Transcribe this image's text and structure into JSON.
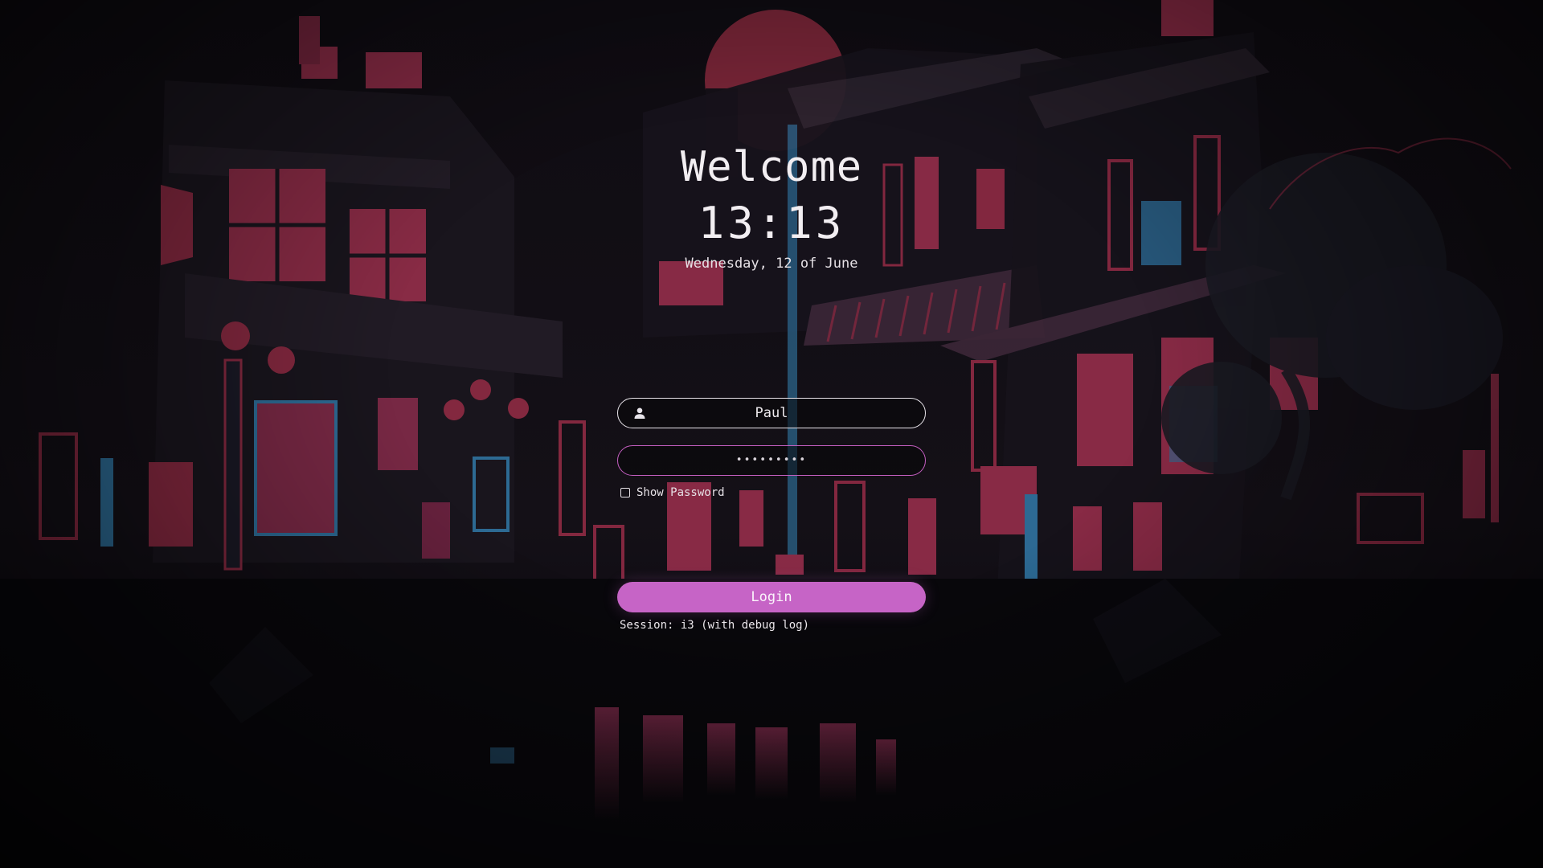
{
  "greeter": {
    "welcome": "Welcome",
    "time": "13:13",
    "date": "Wednesday, 12 of June"
  },
  "form": {
    "username": "Paul",
    "password_mask": "•••••••••",
    "show_password_label": "Show Password",
    "show_password_checked": false,
    "login_label": "Login",
    "session_text": "Session: i3 (with debug log)"
  },
  "icons": {
    "user": "user-icon"
  },
  "colors": {
    "accent": "#c664c6",
    "text": "#f2eef2",
    "neon_pink": "#c0344f",
    "neon_blue": "#2f6f9a"
  }
}
